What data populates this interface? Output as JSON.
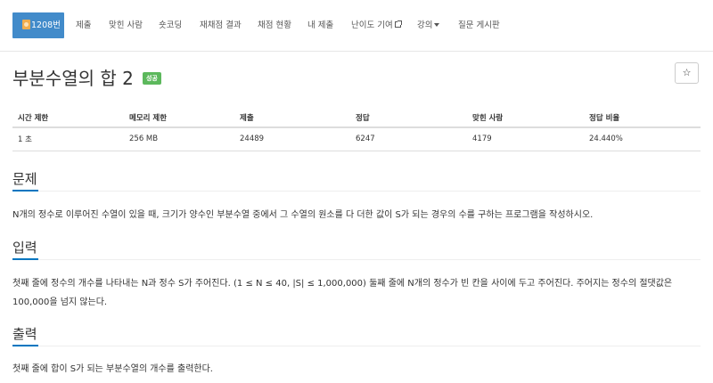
{
  "nav": {
    "items": [
      {
        "label": "1208번",
        "active": true
      },
      {
        "label": "제출"
      },
      {
        "label": "맞힌 사람"
      },
      {
        "label": "숏코딩"
      },
      {
        "label": "재채점 결과"
      },
      {
        "label": "채점 현황"
      },
      {
        "label": "내 제출"
      },
      {
        "label": "난이도 기여"
      },
      {
        "label": "강의"
      },
      {
        "label": "질문 게시판"
      }
    ]
  },
  "problem": {
    "title": "부분수열의 합 2",
    "status_badge": "성공",
    "star": "☆"
  },
  "info_table": {
    "headers": [
      "시간 제한",
      "메모리 제한",
      "제출",
      "정답",
      "맞힌 사람",
      "정답 비율"
    ],
    "row": [
      "1 초",
      "256 MB",
      "24489",
      "6247",
      "4179",
      "24.440%"
    ]
  },
  "sections": {
    "description": {
      "heading": "문제",
      "text": "N개의 정수로 이루어진 수열이 있을 때, 크기가 양수인 부분수열 중에서 그 수열의 원소를 다 더한 값이 S가 되는 경우의 수를 구하는 프로그램을 작성하시오."
    },
    "input": {
      "heading": "입력",
      "text": "첫째 줄에 정수의 개수를 나타내는 N과 정수 S가 주어진다. (1 ≤ N ≤ 40, |S| ≤ 1,000,000) 둘째 줄에 N개의 정수가 빈 칸을 사이에 두고 주어진다. 주어지는 정수의 절댓값은 100,000을 넘지 않는다."
    },
    "output": {
      "heading": "출력",
      "text": "첫째 줄에 합이 S가 되는 부분수열의 개수를 출력한다."
    }
  },
  "colors": {
    "nav_active": "#428bca",
    "badge_success": "#5cb85c",
    "section_underline": "#0076c0"
  }
}
